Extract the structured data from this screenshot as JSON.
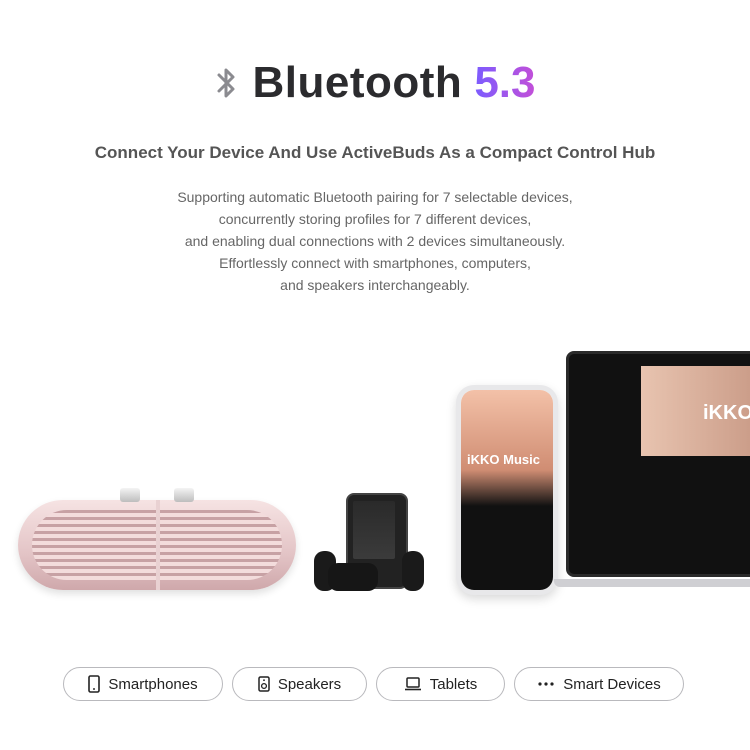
{
  "header": {
    "title_main": "Bluetooth",
    "title_version": "5.3",
    "icon": "bluetooth-icon",
    "accent_gradient": [
      "#7b5cff",
      "#c24fd8"
    ]
  },
  "subtitle": "Connect Your Device And Use ActiveBuds As a Compact Control Hub",
  "description_lines": [
    "Supporting automatic Bluetooth pairing for 7 selectable devices,",
    "concurrently storing profiles for 7 different devices,",
    "and enabling dual connections with 2 devices simultaneously.",
    "Effortlessly connect with smartphones, computers,",
    "and speakers interchangeably."
  ],
  "devices_image": {
    "phone_label": "iKKO Music",
    "laptop_label": "iKKO"
  },
  "categories": [
    {
      "label": "Smartphones",
      "icon": "smartphone-icon"
    },
    {
      "label": "Speakers",
      "icon": "speaker-icon"
    },
    {
      "label": "Tablets",
      "icon": "laptop-icon"
    },
    {
      "label": "Smart Devices",
      "icon": "more-dots-icon"
    }
  ]
}
